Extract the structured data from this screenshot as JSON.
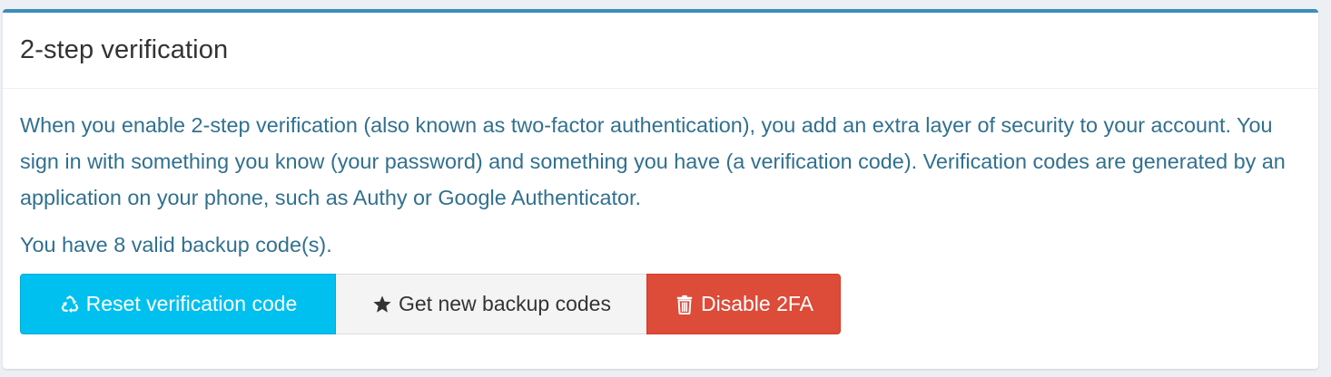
{
  "panel": {
    "title": "2-step verification",
    "description": "When you enable 2-step verification (also known as two-factor authentication), you add an extra layer of security to your account. You sign in with something you know (your password) and something you have (a verification code). Verification codes are generated by an application on your phone, such as Authy or Google Authenticator.",
    "backup_status": "You have 8 valid backup code(s)."
  },
  "buttons": {
    "reset": {
      "label": "Reset verification code",
      "icon": "recycle-icon",
      "color": "#00c0ef"
    },
    "backup": {
      "label": "Get new backup codes",
      "icon": "star-icon",
      "color": "#f4f4f4"
    },
    "disable": {
      "label": "Disable 2FA",
      "icon": "trash-icon",
      "color": "#dd4b39"
    }
  },
  "colors": {
    "accent_border": "#3c8dbc",
    "info_text": "#31708f"
  }
}
